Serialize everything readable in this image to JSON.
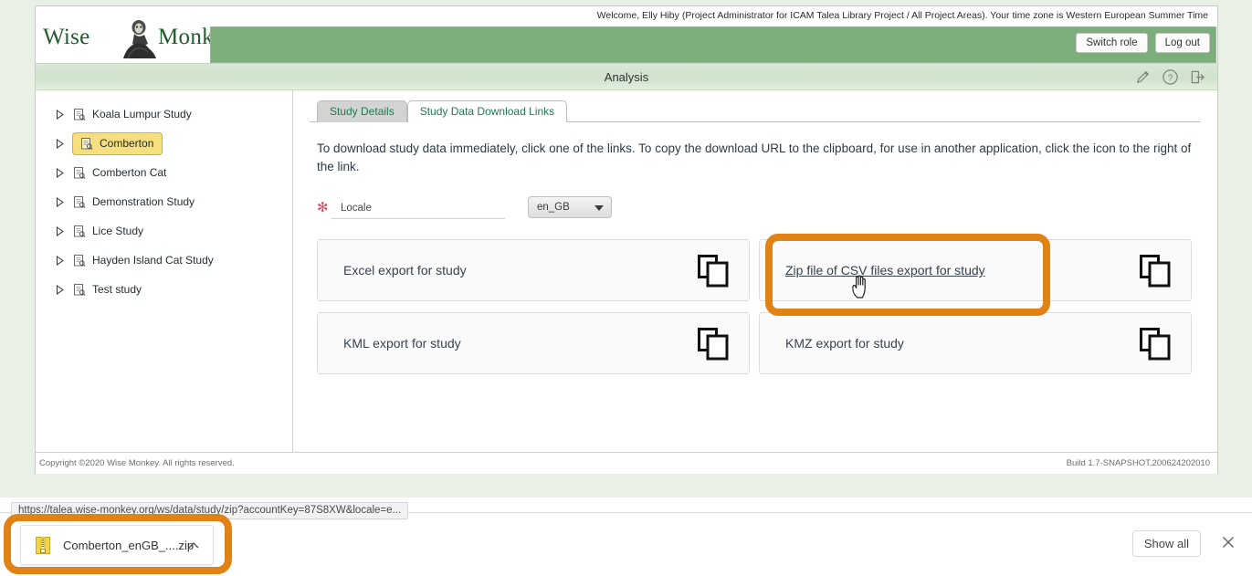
{
  "header": {
    "logo_text_left": "Wise",
    "logo_text_right": "Monkey",
    "welcome": "Welcome, Elly Hiby (Project Administrator for ICAM Talea Library Project / All Project Areas). Your time zone is Western European Summer Time",
    "switch_role_label": "Switch role",
    "logout_label": "Log out",
    "brand_green": "#7bae7b"
  },
  "title_bar": {
    "title": "Analysis",
    "icons": [
      "edit-pencil-icon",
      "help-icon",
      "export-icon"
    ]
  },
  "sidebar": {
    "items": [
      {
        "label": "Koala Lumpur Study",
        "selected": false
      },
      {
        "label": "Comberton",
        "selected": true
      },
      {
        "label": "Comberton Cat",
        "selected": false
      },
      {
        "label": "Demonstration Study",
        "selected": false
      },
      {
        "label": "Lice Study",
        "selected": false
      },
      {
        "label": "Hayden Island Cat Study",
        "selected": false
      },
      {
        "label": "Test study",
        "selected": false
      }
    ],
    "selected_bg": "#f5df7e"
  },
  "tabs": [
    {
      "label": "Study Details",
      "active": false
    },
    {
      "label": "Study Data Download Links",
      "active": true
    }
  ],
  "main": {
    "intro": "To download study data immediately, click one of the links. To copy the download URL to the clipboard, for use in another application, click the icon to the right of the link.",
    "locale": {
      "required_mark": "✻",
      "label": "Locale",
      "value": "en_GB"
    },
    "cards": [
      {
        "label": "Excel export for study",
        "linked": false
      },
      {
        "label": "Zip file of CSV files export for study",
        "linked": true
      },
      {
        "label": "KML export for study",
        "linked": false
      },
      {
        "label": "KMZ export for study",
        "linked": false
      }
    ]
  },
  "footer": {
    "copyright": "Copyright ©2020 Wise Monkey. All rights reserved.",
    "build": "Build 1.7-SNAPSHOT.200624202010"
  },
  "status_bar": {
    "url": "https://talea.wise-monkey.org/ws/data/study/zip?accountKey=87S8XW&locale=e..."
  },
  "downloads": {
    "file_name": "Comberton_enGB_....zip",
    "show_all_label": "Show all"
  },
  "annotations": {
    "color": "#e08214",
    "targets": [
      "zip-csv-export-link",
      "download-item"
    ]
  }
}
